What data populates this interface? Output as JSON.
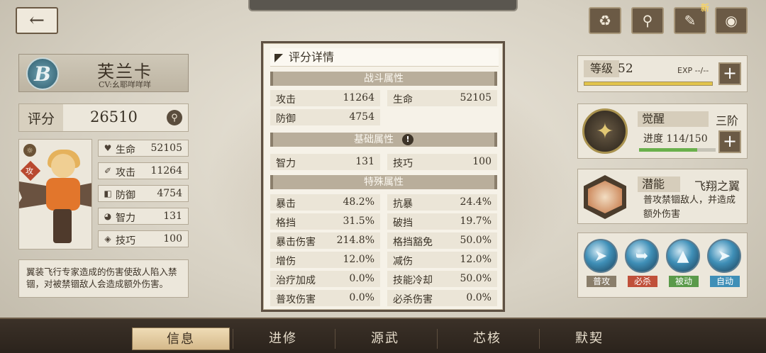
{
  "top": {
    "back_icon": "arrow-left-icon",
    "buttons": [
      {
        "name": "recycle",
        "glyph": "♻"
      },
      {
        "name": "hanger",
        "glyph": "⚲"
      },
      {
        "name": "notes",
        "glyph": "✎",
        "badge": "新"
      },
      {
        "name": "eye",
        "glyph": "◉"
      }
    ]
  },
  "character": {
    "emblem": "B",
    "name": "芙兰卡",
    "cv": "CV:幺耶咩咩咩",
    "score_label": "评分",
    "score_value": "26510"
  },
  "portrait": {
    "class_badge": "攻"
  },
  "stats": [
    {
      "icon": "♥",
      "name": "生命",
      "value": "52105"
    },
    {
      "icon": "✐",
      "name": "攻击",
      "value": "11264"
    },
    {
      "icon": "◧",
      "name": "防御",
      "value": "4754"
    },
    {
      "icon": "◕",
      "name": "智力",
      "value": "131"
    },
    {
      "icon": "◈",
      "name": "技巧",
      "value": "100"
    }
  ],
  "description": "翼装飞行专家造成的伤害使敌人陷入禁锢，对被禁锢敌人会造成额外伤害。",
  "popup": {
    "title": "评分详情",
    "combat_header": "战斗属性",
    "combat": [
      {
        "k": "攻击",
        "v": "11264"
      },
      {
        "k": "生命",
        "v": "52105"
      },
      {
        "k": "防御",
        "v": "4754"
      }
    ],
    "base_header": "基础属性",
    "base": [
      {
        "k": "智力",
        "v": "131"
      },
      {
        "k": "技巧",
        "v": "100"
      }
    ],
    "special_header": "特殊属性",
    "special": [
      {
        "k": "暴击",
        "v": "48.2%"
      },
      {
        "k": "抗暴",
        "v": "24.4%"
      },
      {
        "k": "格挡",
        "v": "31.5%"
      },
      {
        "k": "破挡",
        "v": "19.7%"
      },
      {
        "k": "暴击伤害",
        "v": "214.8%"
      },
      {
        "k": "格挡豁免",
        "v": "50.0%"
      },
      {
        "k": "增伤",
        "v": "12.0%"
      },
      {
        "k": "减伤",
        "v": "12.0%"
      },
      {
        "k": "治疗加成",
        "v": "0.0%"
      },
      {
        "k": "技能冷却",
        "v": "50.0%"
      },
      {
        "k": "普攻伤害",
        "v": "0.0%"
      },
      {
        "k": "必杀伤害",
        "v": "0.0%"
      }
    ]
  },
  "level": {
    "label": "等级",
    "value": "52",
    "exp": "EXP --/--",
    "exp_fraction": 1.0
  },
  "awakening": {
    "label": "觉醒",
    "stage": "三阶",
    "progress_text": "进度  114/150",
    "progress_fraction": 0.76
  },
  "potential": {
    "label": "潜能",
    "name": "飞翔之翼",
    "desc": "普攻禁锢敌人，并造成额外伤害"
  },
  "skills": [
    {
      "tag": "普攻",
      "color": "#8a7e6b"
    },
    {
      "tag": "必杀",
      "color": "#c0503a"
    },
    {
      "tag": "被动",
      "color": "#5a9a4a"
    },
    {
      "tag": "自动",
      "color": "#3f8fb7"
    }
  ],
  "nav": [
    "信息",
    "进修",
    "源武",
    "芯核",
    "默契"
  ]
}
